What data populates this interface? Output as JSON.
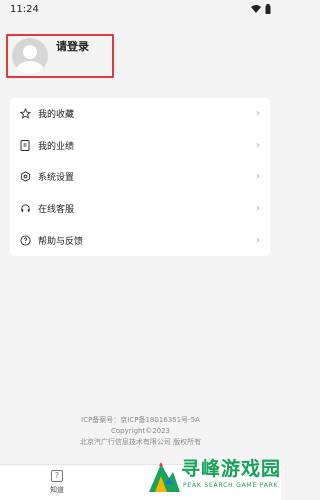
{
  "status_bar": {
    "time": "11:24",
    "icons": [
      "wifi-icon",
      "battery-icon"
    ]
  },
  "profile": {
    "login_label": "请登录",
    "highlight_color": "#e03a3a"
  },
  "menu": {
    "items": [
      {
        "label": "我的收藏",
        "icon": "star-icon"
      },
      {
        "label": "我的业绩",
        "icon": "document-icon"
      },
      {
        "label": "系统设置",
        "icon": "settings-icon"
      },
      {
        "label": "在线客服",
        "icon": "headset-icon"
      },
      {
        "label": "帮助与反馈",
        "icon": "help-icon"
      }
    ]
  },
  "footer": {
    "icp": "ICP备案号：京ICP备18016351号-5A",
    "copyright": "Copyright©2023",
    "company": "北京汽广行信息技术有限公司 版权所有"
  },
  "tab_bar": {
    "tabs": [
      {
        "label": "知道",
        "icon": "question-icon"
      }
    ]
  },
  "watermark": {
    "text": "寻峰游戏园",
    "subtext": "PEAK SEARCH GAME PARK",
    "color": "#17a35a"
  }
}
